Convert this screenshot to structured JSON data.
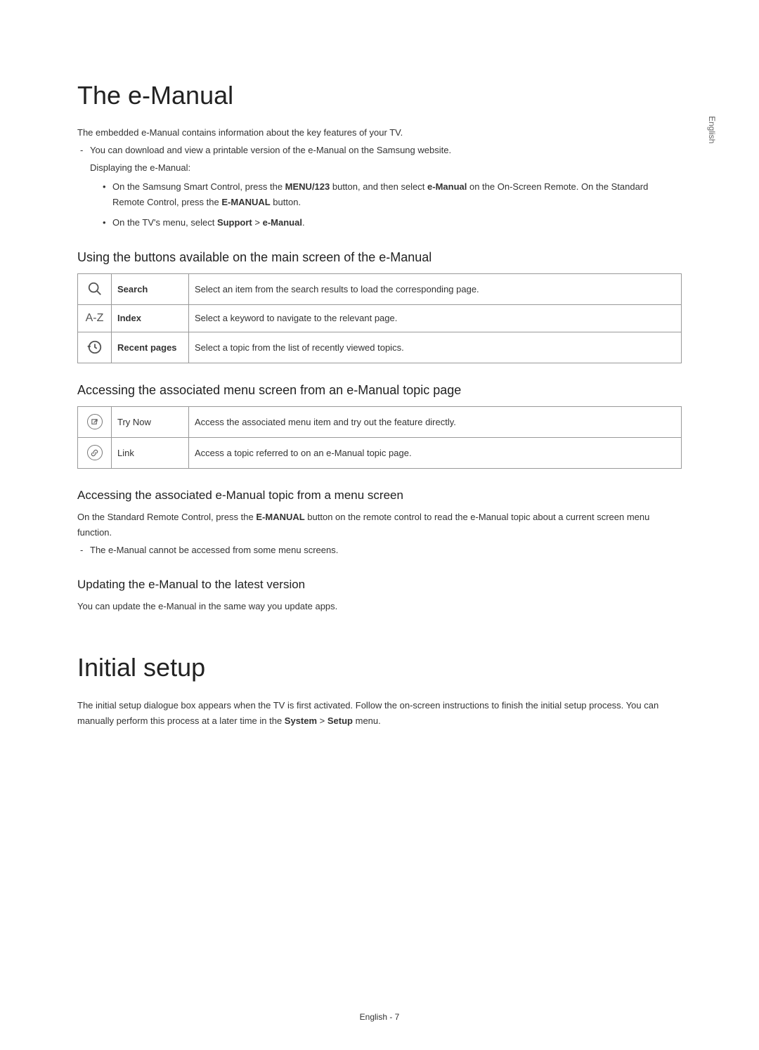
{
  "side_label": "English",
  "section1": {
    "title": "The e-Manual",
    "intro": "The embedded e-Manual contains information about the key features of your TV.",
    "download_note": "You can download and view a printable version of the e-Manual on the Samsung website.",
    "displaying_label": "Displaying the e-Manual:",
    "bullet1_pre": "On the Samsung Smart Control, press the ",
    "bullet1_bold1": "MENU/123",
    "bullet1_mid": " button, and then select ",
    "bullet1_bold2": "e-Manual",
    "bullet1_mid2": " on the On-Screen Remote. On the Standard Remote Control, press the ",
    "bullet1_bold3": "E-MANUAL",
    "bullet1_post": " button.",
    "bullet2_pre": "On the TV's menu, select ",
    "bullet2_bold1": "Support",
    "bullet2_sep": " > ",
    "bullet2_bold2": "e-Manual",
    "bullet2_post": ".",
    "sub1": {
      "heading": "Using the buttons available on the main screen of the e-Manual",
      "rows": [
        {
          "icon": "search",
          "label": "Search",
          "desc": "Select an item from the search results to load the corresponding page."
        },
        {
          "icon": "az",
          "label": "Index",
          "desc": "Select a keyword to navigate to the relevant page."
        },
        {
          "icon": "recent",
          "label": "Recent pages",
          "desc": "Select a topic from the list of recently viewed topics."
        }
      ]
    },
    "sub2": {
      "heading": "Accessing the associated menu screen from an e-Manual topic page",
      "rows": [
        {
          "icon": "trynow",
          "label": "Try Now",
          "desc": "Access the associated menu item and try out the feature directly."
        },
        {
          "icon": "link",
          "label": "Link",
          "desc": "Access a topic referred to on an e-Manual topic page."
        }
      ]
    },
    "sub3": {
      "heading": "Accessing the associated e-Manual topic from a menu screen",
      "para_pre": "On the Standard Remote Control, press the ",
      "para_bold": "E-MANUAL",
      "para_post": " button on the remote control to read the e-Manual topic about a current screen menu function.",
      "note": "The e-Manual cannot be accessed from some menu screens."
    },
    "sub4": {
      "heading": "Updating the e-Manual to the latest version",
      "para": "You can update the e-Manual in the same way you update apps."
    }
  },
  "section2": {
    "title": "Initial setup",
    "para_pre": "The initial setup dialogue box appears when the TV is first activated. Follow the on-screen instructions to finish the initial setup process. You can manually perform this process at a later time in the ",
    "para_bold1": "System",
    "para_sep": " > ",
    "para_bold2": "Setup",
    "para_post": " menu."
  },
  "footer": "English - 7",
  "icon_labels": {
    "search": "search-icon",
    "az": "A-Z",
    "recent": "recent-icon"
  }
}
